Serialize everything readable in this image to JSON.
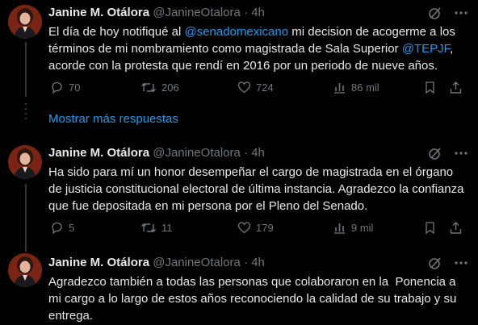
{
  "tweets": [
    {
      "name": "Janine M. Otálora",
      "handle": "@JanineOtalora",
      "separator": "·",
      "time": "4h",
      "text_parts": [
        {
          "text": "El día de hoy notifiqué al "
        },
        {
          "text": "@senadomexicano",
          "mention": true
        },
        {
          "text": " mi decision de acogerme a los términos de mi nombramiento como magistrada de Sala Superior "
        },
        {
          "text": "@TEPJF",
          "mention": true
        },
        {
          "text": ", acorde con la protesta que rendí en 2016 por un periodo de nueve años."
        }
      ],
      "replies": "70",
      "retweets": "206",
      "likes": "724",
      "views": "86 mil"
    },
    {
      "name": "Janine M. Otálora",
      "handle": "@JanineOtalora",
      "separator": "·",
      "time": "4h",
      "text": "Ha sido para mí un honor desempeñar el cargo de magistrada en el órgano de justicia constitucional electoral de última instancia. Agradezco la confianza que fue depositada en mi persona por el Pleno del Senado.",
      "replies": "5",
      "retweets": "11",
      "likes": "179",
      "views": "9 mil"
    },
    {
      "name": "Janine M. Otálora",
      "handle": "@JanineOtalora",
      "separator": "·",
      "time": "4h",
      "text": "Agradezco también a todas las personas que colaboraron en la  Ponencia a mi cargo a lo largo de estos años reconociendo la calidad de su trabajo y su entrega."
    }
  ],
  "show_more_replies": "Mostrar más respuestas",
  "icons": {
    "grok": "grok-icon",
    "more": "more-icon",
    "reply": "reply-icon",
    "retweet": "retweet-icon",
    "like": "like-icon",
    "views": "views-icon",
    "bookmark": "bookmark-icon",
    "share": "share-icon"
  },
  "colors": {
    "background": "#000000",
    "text": "#e7e9ea",
    "muted": "#71767b",
    "link": "#1d9bf0"
  }
}
